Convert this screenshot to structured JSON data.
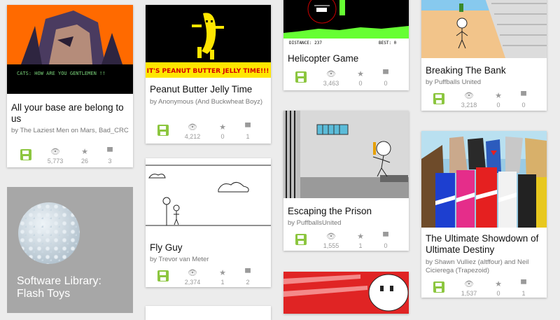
{
  "cards": {
    "c1": {
      "title": "All your base are belong to us",
      "by": "by The Laziest Men on Mars, Bad_CRC",
      "views": "5,773",
      "favs": "26",
      "comments": "3",
      "caption": "CATS: HOW ARE YOU GENTLEMEN !!"
    },
    "c2": {
      "title": "Peanut Butter Jelly Time",
      "by": "by Anonymous (And Buckwheat Boyz)",
      "views": "4,212",
      "favs": "0",
      "comments": "1",
      "caption": "IT'S PEANUT BUTTER JELLY TIME!!!"
    },
    "c3": {
      "title": "Fly Guy",
      "by": "by Trevor van Meter",
      "views": "2,374",
      "favs": "1",
      "comments": "2"
    },
    "c4": {
      "title": "Helicopter Game",
      "by": "",
      "views": "3,463",
      "favs": "0",
      "comments": "0",
      "hud_left": "DISTANCE: 237",
      "hud_right": "BEST: 0"
    },
    "c5": {
      "title": "Escaping the Prison",
      "by": "by PuffballsUnited",
      "views": "1,555",
      "favs": "1",
      "comments": "0"
    },
    "c6": {
      "title": "Breaking The Bank",
      "by": "by Puffballs United",
      "views": "3,218",
      "favs": "0",
      "comments": "0"
    },
    "c7": {
      "title": "The Ultimate Showdown of Ultimate Destiny",
      "by": "by Shawn Vulliez (altffour) and Neil Cicierega (Trapezoid)",
      "views": "1,537",
      "favs": "0",
      "comments": "1"
    }
  },
  "library": {
    "title": "Software Library: Flash Toys"
  },
  "colors": {
    "save_green": "#8cc63f",
    "icon_gray": "#9a9a9a"
  }
}
